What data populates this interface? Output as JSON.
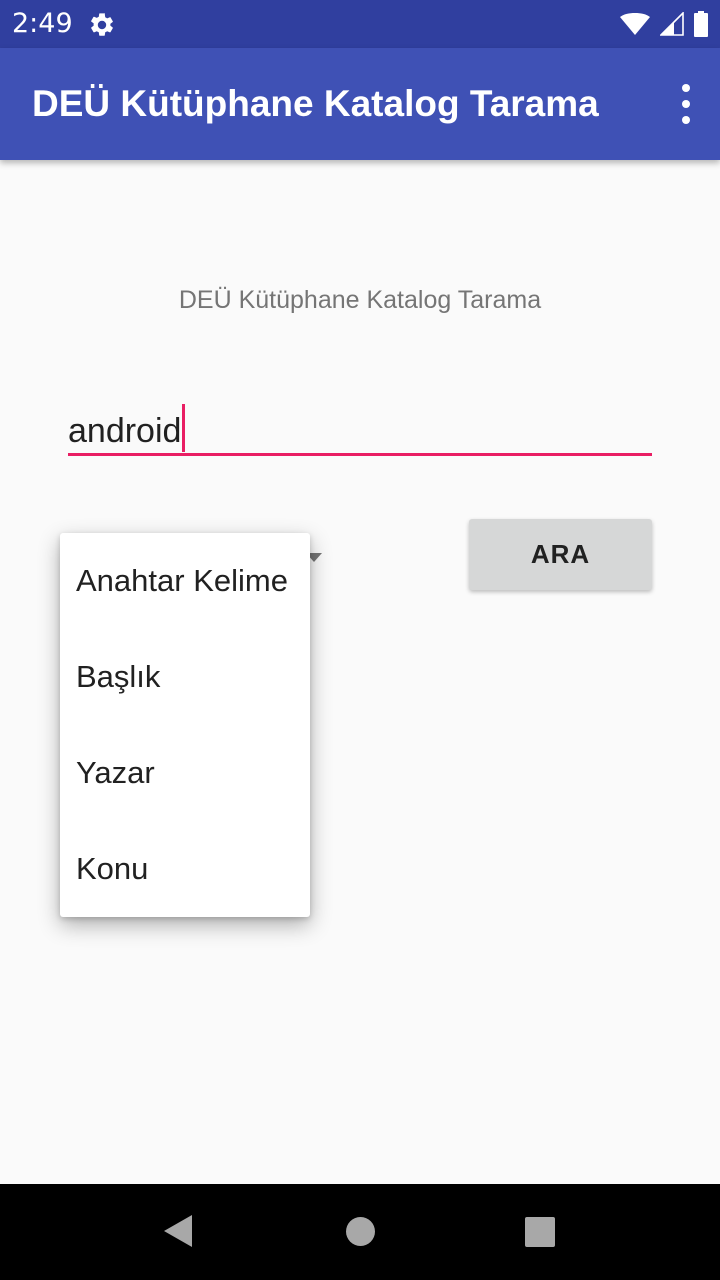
{
  "status_bar": {
    "time": "2:49",
    "icons": [
      "gear-icon",
      "wifi-icon",
      "signal-icon",
      "battery-icon"
    ]
  },
  "app_bar": {
    "title": "DEÜ Kütüphane Katalog Tarama",
    "menu_icon": "more-vert-icon"
  },
  "main": {
    "heading": "DEÜ Kütüphane Katalog Tarama",
    "search": {
      "value": "android"
    },
    "search_button_label": "ARA",
    "spinner": {
      "options": [
        "Anahtar Kelime",
        "Başlık",
        "Yazar",
        "Konu"
      ]
    }
  },
  "nav_bar": {
    "icons": [
      "back-icon",
      "home-icon",
      "recents-icon"
    ]
  },
  "colors": {
    "status_bar": "#303f9f",
    "app_bar": "#3f51b5",
    "accent": "#e91e63",
    "button": "#d6d7d7",
    "background": "#fafafa"
  }
}
